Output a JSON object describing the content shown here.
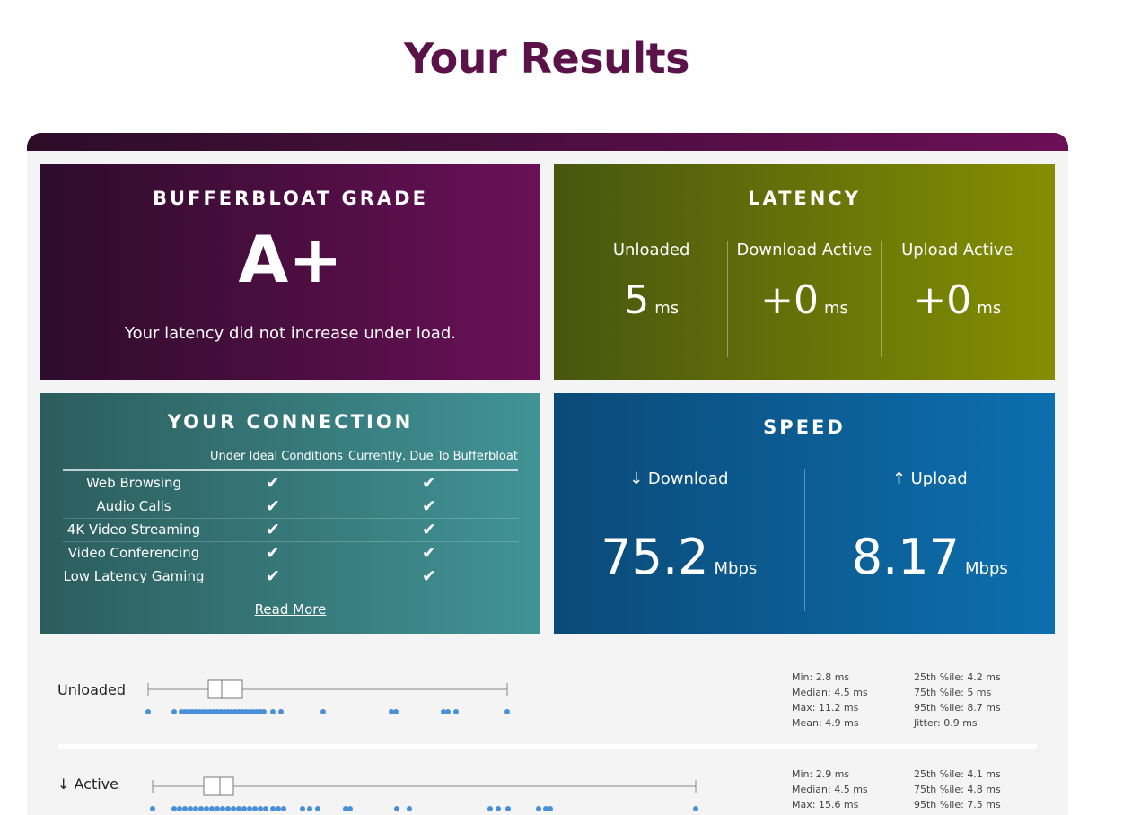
{
  "page": {
    "title": "Your Results"
  },
  "grade": {
    "title": "BUFFERBLOAT GRADE",
    "value": "A+",
    "description": "Your latency did not increase under load."
  },
  "latency": {
    "title": "LATENCY",
    "columns": [
      {
        "label": "Unloaded",
        "value": "5",
        "unit": "ms"
      },
      {
        "label": "Download Active",
        "value": "+0",
        "unit": "ms"
      },
      {
        "label": "Upload Active",
        "value": "+0",
        "unit": "ms"
      }
    ]
  },
  "connection": {
    "title": "YOUR CONNECTION",
    "headers": [
      "Under Ideal Conditions",
      "Currently, Due To Bufferbloat"
    ],
    "rows": [
      {
        "name": "Web Browsing",
        "ideal": "✔",
        "current": "✔"
      },
      {
        "name": "Audio Calls",
        "ideal": "✔",
        "current": "✔"
      },
      {
        "name": "4K Video Streaming",
        "ideal": "✔",
        "current": "✔"
      },
      {
        "name": "Video Conferencing",
        "ideal": "✔",
        "current": "✔"
      },
      {
        "name": "Low Latency Gaming",
        "ideal": "✔",
        "current": "✔"
      }
    ],
    "read_more": "Read More"
  },
  "speed": {
    "title": "SPEED",
    "download": {
      "label": "↓ Download",
      "value": "75.2",
      "unit": "Mbps"
    },
    "upload": {
      "label": "↑ Upload",
      "value": "8.17",
      "unit": "Mbps"
    }
  },
  "boxplots": [
    {
      "label": "Unloaded",
      "min": 2.8,
      "q1": 4.2,
      "median": 4.5,
      "q3": 5,
      "max": 11.2,
      "stats_left": [
        "Min: 2.8 ms",
        "Median: 4.5 ms",
        "Max: 11.2 ms",
        "Mean: 4.9 ms"
      ],
      "stats_right": [
        "25th %ile: 4.2 ms",
        "75th %ile: 5 ms",
        "95th %ile: 8.7 ms",
        "Jitter: 0.9 ms"
      ]
    },
    {
      "label": "↓ Active",
      "min": 2.9,
      "q1": 4.1,
      "median": 4.5,
      "q3": 4.8,
      "max": 15.6,
      "stats_left": [
        "Min: 2.9 ms",
        "Median: 4.5 ms",
        "Max: 15.6 ms"
      ],
      "stats_right": [
        "25th %ile: 4.1 ms",
        "75th %ile: 4.8 ms",
        "95th %ile: 7.5 ms"
      ]
    }
  ],
  "colors": {
    "grade": "#6a1057",
    "latency": "#858e02",
    "connection": "#419396",
    "speed": "#0c6fae",
    "dots": "#4a90d9"
  }
}
